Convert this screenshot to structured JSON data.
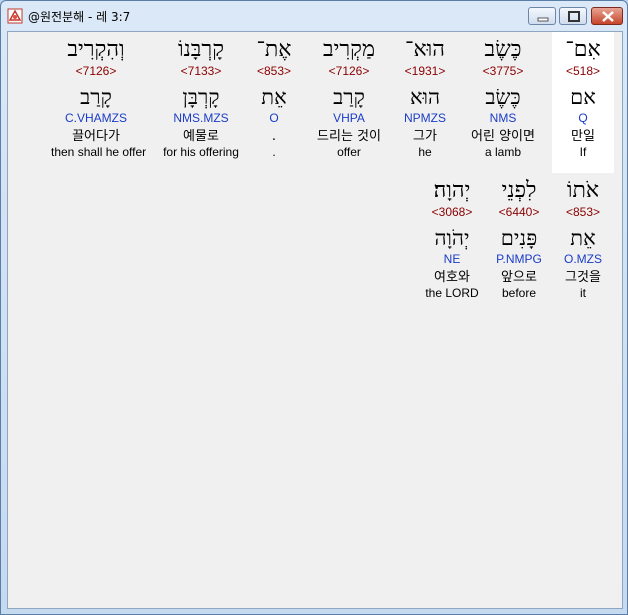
{
  "window": {
    "title": "@원전분해 - 레 3:7",
    "icon": "bible-app-icon",
    "controls": [
      "minimize",
      "maximize",
      "close"
    ]
  },
  "rows": [
    {
      "words": [
        {
          "heb": "אִם־",
          "num": "<518>",
          "root": "אם",
          "morph": "Q",
          "kor": "만일",
          "eng": "If"
        },
        {
          "heb": "כֶּשֶׂב",
          "num": "<3775>",
          "root": "כֶּשֶׂב",
          "morph": "NMS",
          "kor": "어린 양이면",
          "eng": "a lamb"
        },
        {
          "heb": "הוּא־",
          "num": "<1931>",
          "root": "הוּא",
          "morph": "NPMZS",
          "kor": "그가",
          "eng": "he"
        },
        {
          "heb": "מַקְרִיב",
          "num": "<7126>",
          "root": "קָרַב",
          "morph": "VHPA",
          "kor": "드리는 것이",
          "eng": "offer"
        },
        {
          "heb": "אֶת־",
          "num": "<853>",
          "root": "אֵת",
          "morph": "O",
          "kor": ".",
          "eng": "."
        },
        {
          "heb": "קָרְבָּנוֹ",
          "num": "<7133>",
          "root": "קָרְבָּן",
          "morph": "NMS.MZS",
          "kor": "예물로",
          "eng": "for his offering"
        },
        {
          "heb": "וְהִקְרִיב",
          "num": "<7126>",
          "root": "קָרַב",
          "morph": "C.VHAMZS",
          "kor": "끌어다가",
          "eng": "then shall he offer"
        }
      ]
    },
    {
      "words": [
        {
          "heb": "אֹתוֹ",
          "num": "<853>",
          "root": "אֵת",
          "morph": "O.MZS",
          "kor": "그것을",
          "eng": "it"
        },
        {
          "heb": "לִפְנֵי",
          "num": "<6440>",
          "root": "פָּנִים",
          "morph": "P.NMPG",
          "kor": "앞으로",
          "eng": "before"
        },
        {
          "heb": "יְהוָה׃",
          "num": "<3068>",
          "root": "יְהֹוָה",
          "morph": "NE",
          "kor": "여호와",
          "eng": "the LORD"
        }
      ]
    }
  ]
}
